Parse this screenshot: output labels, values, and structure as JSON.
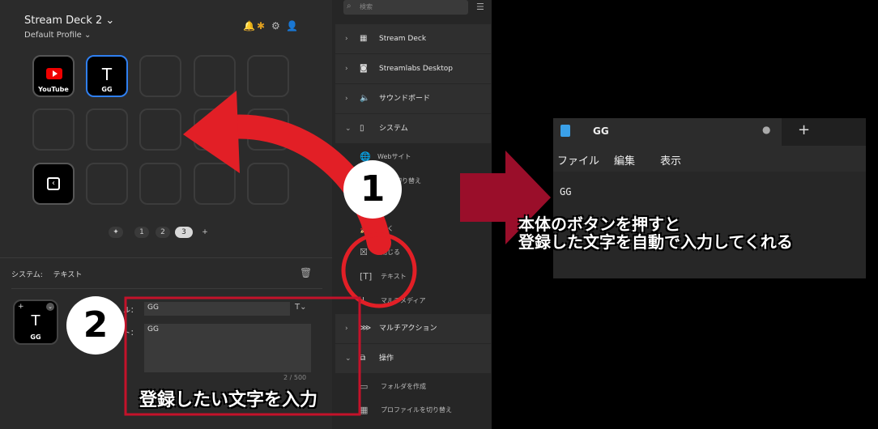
{
  "app": {
    "title": "Stream Deck 2 ⌄",
    "profile": "Default Profile ⌄"
  },
  "header_icons": [
    "bell-icon",
    "plugin-icon",
    "gear-icon",
    "user-icon"
  ],
  "keys": {
    "youtube_label": "YouTube",
    "text_key_label": "GG",
    "text_key_glyph": "T"
  },
  "pager": {
    "pages": [
      "1",
      "2",
      "3"
    ],
    "active": "3",
    "add": "+"
  },
  "property_panel": {
    "breadcrumb_a": "システム:",
    "breadcrumb_b": "テキスト",
    "title_suffix": "ル：",
    "title_value": "GG",
    "text_suffix": "ト：",
    "text_value": "GG",
    "counter": "2 / 500",
    "key_label": "GG"
  },
  "actions_panel": {
    "search_placeholder": "検索",
    "categories": [
      {
        "label": "Stream Deck"
      },
      {
        "label": "Streamlabs Desktop"
      },
      {
        "label": "サウンドボード"
      },
      {
        "label": "システム"
      }
    ],
    "system_items": [
      "Webサイト",
      "ーの切り替え",
      "開く",
      "閉じる",
      "テキスト",
      "マルチメディア"
    ],
    "more_categories": [
      "マルチアクション",
      "操作"
    ],
    "operation_items": [
      "フォルダを作成",
      "プロファイルを切り替え"
    ]
  },
  "notepad": {
    "tab_title": "GG",
    "new_tab": "+",
    "menu": [
      "ファイル",
      "編集",
      "表示"
    ],
    "content": "GG"
  },
  "annotations": {
    "step1": "1",
    "step2": "2",
    "caption_right_line1": "本体のボタンを押すと",
    "caption_right_line2": "登録した文字を自動で入力してくれる",
    "caption_bottom": "登録したい文字を入力"
  },
  "colors": {
    "accent_blue": "#2f7ff0",
    "arrow_red": "#e21f26",
    "arrow_dark_red": "#9a0e2a",
    "highlight_red": "#e21f26"
  }
}
